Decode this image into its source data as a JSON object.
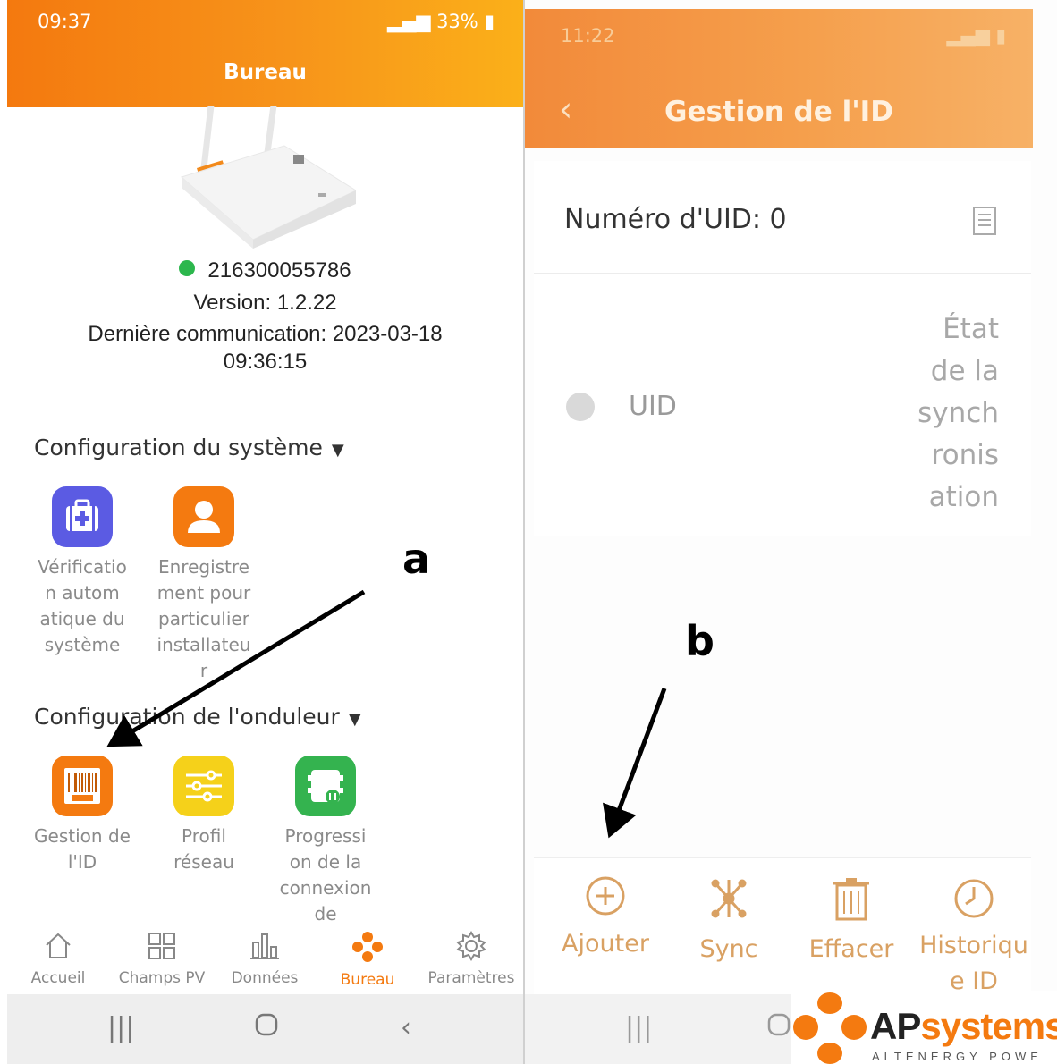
{
  "left_screen": {
    "status_time": "09:37",
    "status_battery": "33%",
    "title": "Bureau",
    "device": {
      "serial": "216300055786",
      "version": "Version: 1.2.22",
      "last_comm_line1": "Dernière communication: 2023-03-18",
      "last_comm_line2": "09:36:15",
      "status_color": "#2cb74d"
    },
    "system_config": {
      "title": "Configuration du système",
      "tiles": [
        {
          "label_lines": [
            "Vérificatio",
            "n autom",
            "atique du",
            "système"
          ],
          "icon": "medkit-icon",
          "color": "#5b5be3"
        },
        {
          "label_lines": [
            "Enregistre",
            "ment pour",
            "particulier",
            "installateu",
            "r"
          ],
          "icon": "person-icon",
          "color": "#f47a10"
        }
      ]
    },
    "inverter_config": {
      "title": "Configuration de l'onduleur",
      "tiles": [
        {
          "label_lines": [
            "Gestion de",
            "l'ID"
          ],
          "icon": "barcode-icon",
          "color": "#f47a10"
        },
        {
          "label_lines": [
            "Profil",
            "réseau"
          ],
          "icon": "sliders-icon",
          "color": "#f5d11a"
        },
        {
          "label_lines": [
            "Progressi",
            "on de la",
            "connexion",
            "de"
          ],
          "icon": "inverter-icon",
          "color": "#34b34f"
        }
      ]
    },
    "bottom_nav": [
      {
        "label": "Accueil",
        "icon": "home-icon"
      },
      {
        "label": "Champs PV",
        "icon": "grid-icon"
      },
      {
        "label": "Données",
        "icon": "bar-chart-icon"
      },
      {
        "label": "Bureau",
        "icon": "bureau-icon",
        "active": true
      },
      {
        "label": "Paramètres",
        "icon": "gear-icon"
      }
    ]
  },
  "right_screen": {
    "status_time": "11:22",
    "title": "Gestion de l'ID",
    "uid_number": "Numéro d'UID: 0",
    "table_header": {
      "uid": "UID",
      "state_lines": [
        "État",
        "de la",
        "synch",
        "ronis",
        "ation"
      ]
    },
    "toolbar": [
      {
        "label_lines": [
          "Ajouter"
        ],
        "icon": "add-circle-icon"
      },
      {
        "label_lines": [
          "Sync"
        ],
        "icon": "sync-network-icon"
      },
      {
        "label_lines": [
          "Effacer"
        ],
        "icon": "trash-icon"
      },
      {
        "label_lines": [
          "Historiqu",
          "e ID"
        ],
        "icon": "clock-icon"
      }
    ]
  },
  "annotations": {
    "a": "a",
    "b": "b"
  },
  "logo": {
    "brand_ap": "AP",
    "brand_systems": "systems",
    "tagline": "ALTENERGY POWE"
  },
  "colors": {
    "accent": "#f47a10",
    "header_gradient_end": "#fbb019"
  }
}
